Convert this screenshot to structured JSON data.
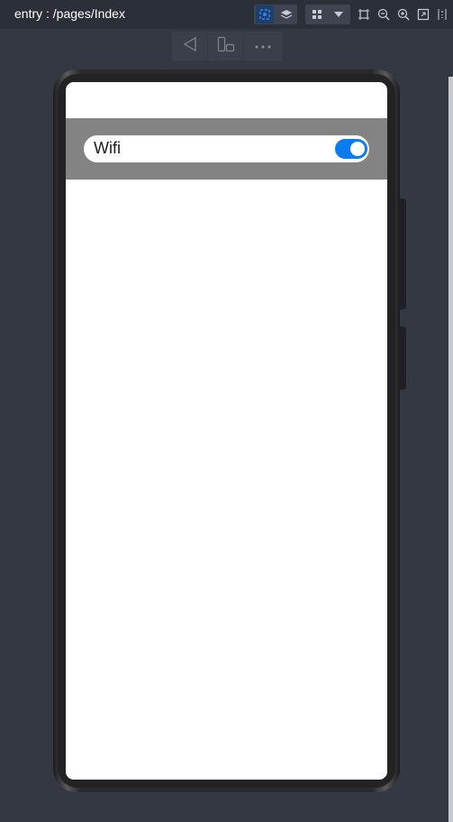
{
  "window": {
    "title": "entry : /pages/Index"
  },
  "toolbar": {
    "icons": [
      "inspect-icon",
      "layers-icon",
      "grid-icon",
      "dropdown-icon",
      "frame-icon",
      "zoom-out-icon",
      "zoom-in-icon",
      "fit-screen-icon",
      "ruler-icon"
    ],
    "active_color": "#1e6fd9"
  },
  "device_toolbar": {
    "icons": [
      "back-icon",
      "rotate-device-icon",
      "more-icon"
    ]
  },
  "app": {
    "wifi": {
      "label": "Wifi",
      "enabled": true,
      "accent": "#0a7cf0"
    },
    "band_color": "#838383"
  }
}
